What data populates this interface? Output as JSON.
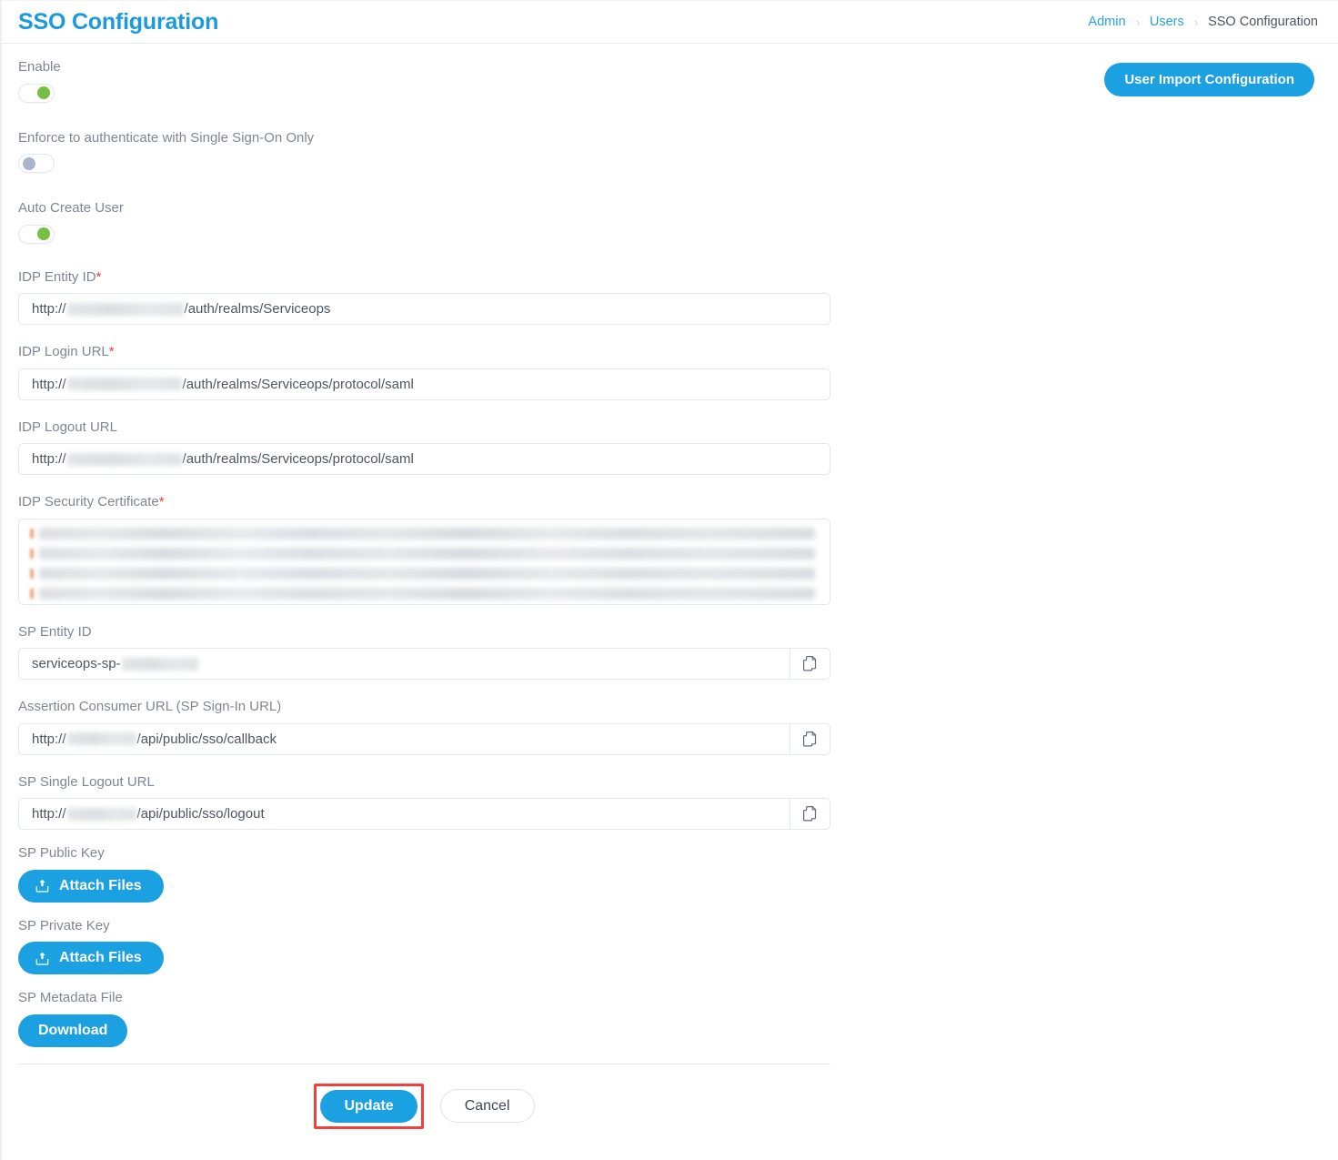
{
  "header": {
    "title": "SSO Configuration",
    "breadcrumb": [
      {
        "label": "Admin",
        "current": false
      },
      {
        "label": "Users",
        "current": false
      },
      {
        "label": "SSO Configuration",
        "current": true
      }
    ],
    "separator": "›"
  },
  "actions": {
    "user_import_configuration": "User Import Configuration"
  },
  "toggles": {
    "enable": {
      "label": "Enable",
      "state": "on"
    },
    "enforce_sso": {
      "label": "Enforce to authenticate with Single Sign-On Only",
      "state": "off"
    },
    "auto_create_user": {
      "label": "Auto Create User",
      "state": "on"
    }
  },
  "fields": {
    "idp_entity_id": {
      "label": "IDP Entity ID",
      "required": true,
      "value_prefix": "http://",
      "value_redacted": true,
      "value_suffix": "/auth/realms/Serviceops"
    },
    "idp_login_url": {
      "label": "IDP Login URL",
      "required": true,
      "value_prefix": "http://",
      "value_redacted": true,
      "value_suffix": "/auth/realms/Serviceops/protocol/saml"
    },
    "idp_logout_url": {
      "label": "IDP Logout URL",
      "required": false,
      "value_prefix": "http://",
      "value_redacted": true,
      "value_suffix": "/auth/realms/Serviceops/protocol/saml"
    },
    "idp_security_certificate": {
      "label": "IDP Security Certificate",
      "required": true,
      "value_redacted": true,
      "redacted_lines": 4
    },
    "sp_entity_id": {
      "label": "SP Entity ID",
      "required": false,
      "value_prefix": "serviceops-sp-",
      "value_redacted": true,
      "value_suffix": "",
      "copy": true
    },
    "assertion_consumer_url": {
      "label": "Assertion Consumer URL (SP Sign-In URL)",
      "required": false,
      "value_prefix": "http://",
      "value_redacted": true,
      "value_suffix": "/api/public/sso/callback",
      "copy": true
    },
    "sp_single_logout_url": {
      "label": "SP Single Logout URL",
      "required": false,
      "value_prefix": "http://",
      "value_redacted": true,
      "value_suffix": "/api/public/sso/logout",
      "copy": true
    },
    "sp_public_key": {
      "label": "SP Public Key",
      "button": "Attach Files"
    },
    "sp_private_key": {
      "label": "SP Private Key",
      "button": "Attach Files"
    },
    "sp_metadata_file": {
      "label": "SP Metadata File",
      "button": "Download"
    }
  },
  "footer": {
    "update": "Update",
    "cancel": "Cancel"
  },
  "icons": {
    "copy": "copy-icon",
    "upload": "upload-icon",
    "chevron_right": "chevron-right-icon"
  },
  "colors": {
    "accent_blue": "#1ba0e2",
    "title_blue": "#1b9ae0",
    "toggle_on_green": "#76c043",
    "toggle_off_gray": "#a8b6cc",
    "required_red": "#e8453c",
    "highlight_red": "#f2403a",
    "label_gray": "#7d8795"
  }
}
